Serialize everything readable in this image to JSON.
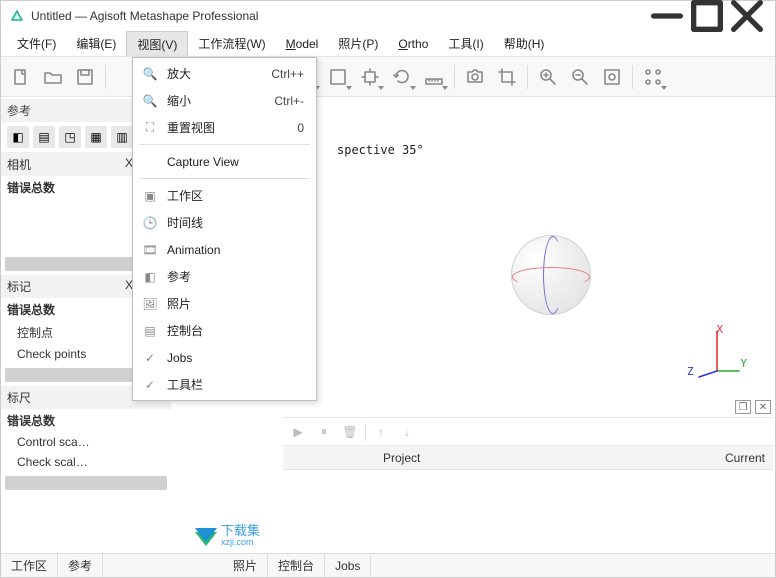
{
  "window": {
    "title": "Untitled — Agisoft Metashape Professional"
  },
  "menubar": {
    "file": "文件(F)",
    "edit": "编辑(E)",
    "view": "视图(V)",
    "workflow": "工作流程(W)",
    "model": "Model",
    "photo": "照片(P)",
    "ortho": "Ortho",
    "tools": "工具(I)",
    "help": "帮助(H)"
  },
  "view_menu": {
    "zoom_in": "放大",
    "zoom_in_sc": "Ctrl++",
    "zoom_out": "缩小",
    "zoom_out_sc": "Ctrl+-",
    "reset_view": "重置视图",
    "reset_view_sc": "0",
    "capture": "Capture View",
    "workspace": "工作区",
    "timeline": "时间线",
    "animation": "Animation",
    "reference": "参考",
    "photos": "照片",
    "console": "控制台",
    "jobs": "Jobs",
    "toolbar": "工具栏"
  },
  "left": {
    "reference": "参考",
    "camera": "相机",
    "xcol": "X (m",
    "errors": "错误总数",
    "markers": "标记",
    "control_pts": "控制点",
    "check_pts": "Check points",
    "scale": "标尺",
    "control_sca": "Control sca…",
    "check_sca": "Check scal…"
  },
  "viewport": {
    "info": "spective 35°",
    "ax_x": "X",
    "ax_y": "Y",
    "ax_z": "Z"
  },
  "jobs": {
    "project": "Project",
    "current": "Current"
  },
  "tabs": {
    "workspace": "工作区",
    "reference": "参考",
    "photos": "照片",
    "console": "控制台",
    "jobs": "Jobs"
  },
  "watermark": {
    "name": "下载集",
    "url": "xzji.com"
  }
}
